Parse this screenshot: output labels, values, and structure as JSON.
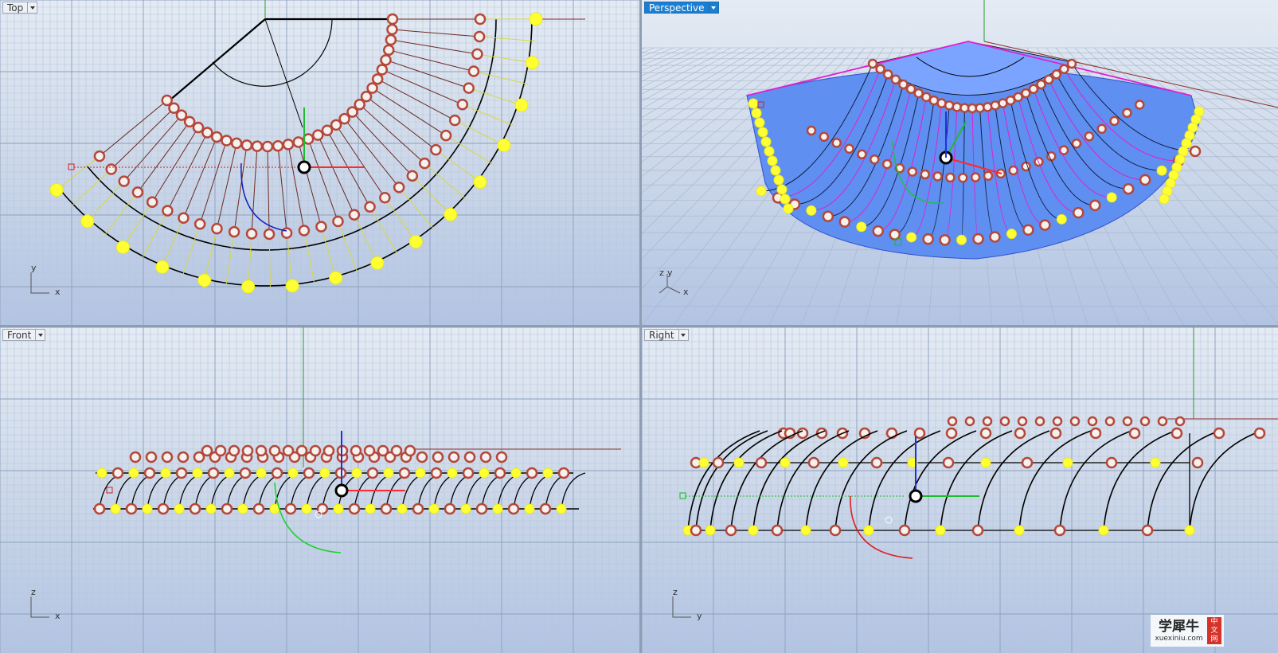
{
  "viewports": {
    "top": {
      "label": "Top",
      "axis_v": "y",
      "axis_h": "x"
    },
    "perspective": {
      "label": "Perspective",
      "axis_1": "z",
      "axis_2": "y",
      "axis_3": "x"
    },
    "front": {
      "label": "Front",
      "axis_v": "z",
      "axis_h": "x"
    },
    "right": {
      "label": "Right",
      "axis_v": "z",
      "axis_h": "y"
    }
  },
  "watermark": {
    "brand": "学犀牛",
    "url": "xuexiniu.com",
    "badge": [
      "中",
      "文",
      "网"
    ]
  },
  "colors": {
    "grid": "#b8c5d9",
    "control_point_ring": "#b5473a",
    "selected_point": "#ffff33",
    "surface": "#5f8ff0",
    "gumball_x": "#ff2a2a",
    "gumball_y": "#1bbd2c",
    "gumball_z": "#2030e0",
    "highlight_edge": "#e020d0",
    "active_tab": "#1b7fd1"
  }
}
